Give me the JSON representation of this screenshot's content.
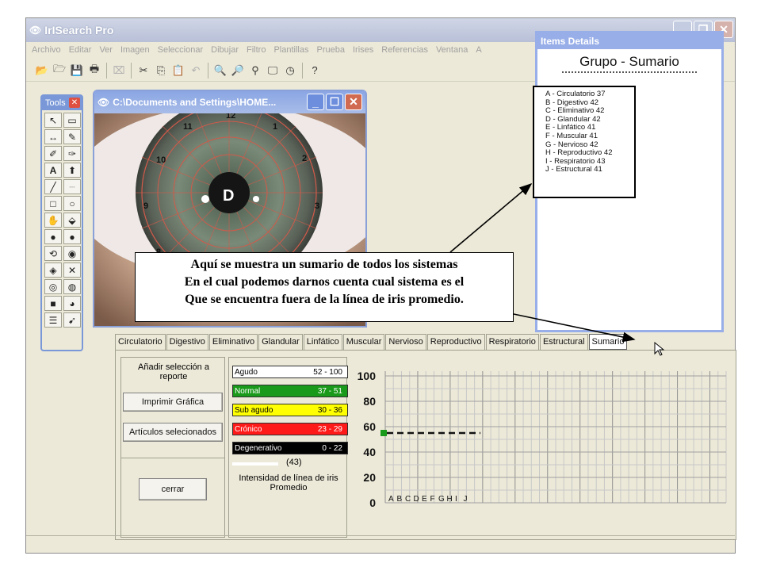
{
  "app": {
    "title": "IrISearch Pro"
  },
  "menu": [
    "Archivo",
    "Editar",
    "Ver",
    "Imagen",
    "Seleccionar",
    "Dibujar",
    "Filtro",
    "Plantillas",
    "Prueba",
    "Irises",
    "Referencias",
    "Ventana",
    "A"
  ],
  "tools_panel": {
    "title": "Tools"
  },
  "image_window": {
    "title": "C:\\Documents and Settings\\HOME...",
    "eye_label": "D",
    "clock": [
      "12",
      "11",
      "10",
      "1",
      "2",
      "3",
      "4",
      "8",
      "9"
    ]
  },
  "details": {
    "title": "Items Details",
    "heading": "Grupo - Sumario",
    "items": [
      "A - Circulatorio  37",
      "B - Digestivo  42",
      "C - Eliminativo  42",
      "D - Glandular  42",
      "E - Linfático  41",
      "F - Muscular  41",
      "G - Nervioso  42",
      "H - Reproductivo  42",
      "I  - Respiratorio  43",
      "J  - Estructural  41"
    ]
  },
  "callout": {
    "line1": "Aquí se muestra  un sumario de todos los sistemas",
    "line2": "En el cual podemos darnos cuenta cual sistema es el",
    "line3": "Que se encuentra fuera de la línea de iris promedio."
  },
  "tabs": [
    "Circulatorio",
    "Digestivo",
    "Eliminativo",
    "Glandular",
    "Linfático",
    "Muscular",
    "Nervioso",
    "Reproductivo",
    "Respiratorio",
    "Estructural",
    "Sumario"
  ],
  "active_tab": "Sumario",
  "buttons": {
    "add": "Añadir selección a reporte",
    "print": "Imprimir Gráfica",
    "articles": "Artículos selecionados",
    "close": "cerrar"
  },
  "legend": [
    {
      "name": "Agudo",
      "range": "52 - 100",
      "bg": "#ffffff",
      "fg": "#000000"
    },
    {
      "name": "Normal",
      "range": "37 - 51",
      "bg": "#1a9a1a",
      "fg": "#ffffff"
    },
    {
      "name": "Sub agudo",
      "range": "30 - 36",
      "bg": "#ffff00",
      "fg": "#000000"
    },
    {
      "name": "Crónico",
      "range": "23 - 29",
      "bg": "#ff1a1a",
      "fg": "#ffffff"
    },
    {
      "name": "Degenerativo",
      "range": "0 - 22",
      "bg": "#000000",
      "fg": "#ffffff"
    }
  ],
  "intensity": {
    "value": "(43)",
    "label": "Intensidad  de línea de iris Promedio"
  },
  "chart_data": {
    "type": "line",
    "y_ticks": [
      "100",
      "80",
      "60",
      "40",
      "20",
      "0"
    ],
    "ylim": [
      0,
      100
    ],
    "categories": [
      "A",
      "B",
      "C",
      "D",
      "E",
      "F",
      "G",
      "H",
      "I",
      "J"
    ],
    "series": [
      {
        "values": [
          55,
          55,
          55,
          55,
          55,
          55,
          55,
          55,
          55,
          55
        ]
      }
    ],
    "grid": true
  }
}
